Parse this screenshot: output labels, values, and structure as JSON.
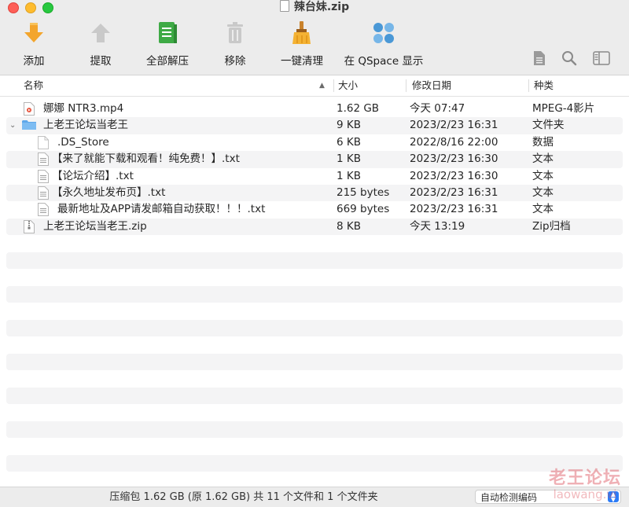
{
  "window": {
    "title": "辣台妹.zip"
  },
  "toolbar": {
    "add": "添加",
    "extract": "提取",
    "extract_all": "全部解压",
    "remove": "移除",
    "clean": "一键清理",
    "qspace": "在 QSpace 显示"
  },
  "columns": {
    "name": "名称",
    "size": "大小",
    "date": "修改日期",
    "kind": "种类"
  },
  "files": [
    {
      "name": "娜娜 NTR3.mp4",
      "size": "1.62 GB",
      "date": "今天 07:47",
      "kind": "MPEG-4影片",
      "type": "video"
    },
    {
      "name": "上老王论坛当老王",
      "size": "9 KB",
      "date": "2023/2/23 16:31",
      "kind": "文件夹",
      "type": "folder"
    },
    {
      "name": ".DS_Store",
      "size": "6 KB",
      "date": "2022/8/16 22:00",
      "kind": "数据",
      "type": "file"
    },
    {
      "name": "【来了就能下载和观看！纯免费！】.txt",
      "size": "1 KB",
      "date": "2023/2/23 16:30",
      "kind": "文本",
      "type": "text"
    },
    {
      "name": "【论坛介绍】.txt",
      "size": "1 KB",
      "date": "2023/2/23 16:30",
      "kind": "文本",
      "type": "text"
    },
    {
      "name": "【永久地址发布页】.txt",
      "size": "215 bytes",
      "date": "2023/2/23 16:31",
      "kind": "文本",
      "type": "text"
    },
    {
      "name": "最新地址及APP请发邮箱自动获取！！！.txt",
      "size": "669 bytes",
      "date": "2023/2/23 16:31",
      "kind": "文本",
      "type": "text"
    },
    {
      "name": "上老王论坛当老王.zip",
      "size": "8 KB",
      "date": "今天 13:19",
      "kind": "Zip归档",
      "type": "zip"
    }
  ],
  "status": {
    "summary": "压缩包 1.62 GB (原 1.62 GB) 共 11 个文件和 1 个文件夹",
    "encoding": "自动检测编码"
  },
  "watermark": {
    "line1": "老王论坛",
    "line2": "laowang.vi"
  },
  "colors": {
    "add_arrow": "#f3a52c",
    "extract_all_green": "#3eaa45",
    "qspace_blue": "#4a98d6",
    "folder_blue": "#5fa8ea"
  }
}
